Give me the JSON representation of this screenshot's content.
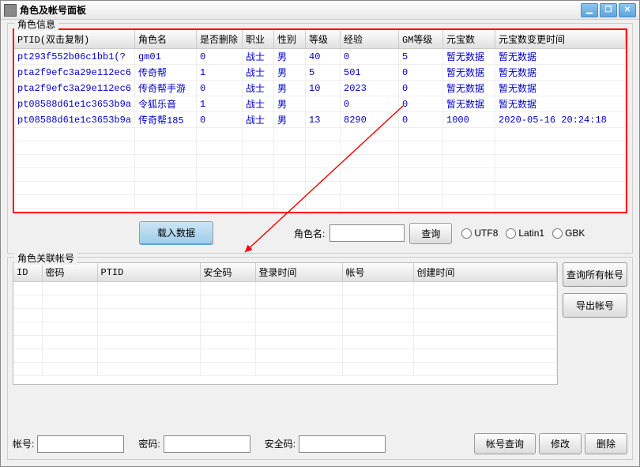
{
  "window": {
    "title": "角色及帐号面板"
  },
  "fieldset1": {
    "title": "角色信息"
  },
  "fieldset2": {
    "title": "角色关联帐号"
  },
  "table1": {
    "headers": [
      "PTID(双击复制)",
      "角色名",
      "是否删除",
      "职业",
      "性别",
      "等级",
      "经验",
      "GM等级",
      "元宝数",
      "元宝数变更时间"
    ],
    "rows": [
      [
        "pt293f552b06c1bb1(?",
        "gm01",
        "0",
        "战士",
        "男",
        "40",
        "0",
        "5",
        "暂无数据",
        "暂无数据"
      ],
      [
        "pta2f9efc3a29e112ec6",
        "传奇帮",
        "1",
        "战士",
        "男",
        "5",
        "501",
        "0",
        "暂无数据",
        "暂无数据"
      ],
      [
        "pta2f9efc3a29e112ec6",
        "传奇帮手游",
        "0",
        "战士",
        "男",
        "10",
        "2023",
        "0",
        "暂无数据",
        "暂无数据"
      ],
      [
        "pt08588d61e1c3653b9a",
        "令狐乐音",
        "1",
        "战士",
        "男",
        "",
        "0",
        "0",
        "暂无数据",
        "暂无数据"
      ],
      [
        "pt08588d61e1c3653b9a",
        "传奇帮185",
        "0",
        "战士",
        "男",
        "13",
        "8290",
        "0",
        "1000",
        "2020-05-16 20:24:18"
      ]
    ]
  },
  "table2": {
    "headers": [
      "ID",
      "密码",
      "PTID",
      "安全码",
      "登录时间",
      "帐号",
      "创建时间"
    ]
  },
  "controls": {
    "loadBtn": "载入数据",
    "roleLabel": "角色名:",
    "queryBtn": "查询",
    "enc": {
      "utf8": "UTF8",
      "latin1": "Latin1",
      "gbk": "GBK"
    }
  },
  "side": {
    "queryAll": "查询所有帐号",
    "export": "导出帐号"
  },
  "bottom": {
    "acctLabel": "帐号:",
    "pwdLabel": "密码:",
    "secLabel": "安全码:",
    "acctQuery": "帐号查询",
    "modify": "修改",
    "delete": "删除"
  }
}
